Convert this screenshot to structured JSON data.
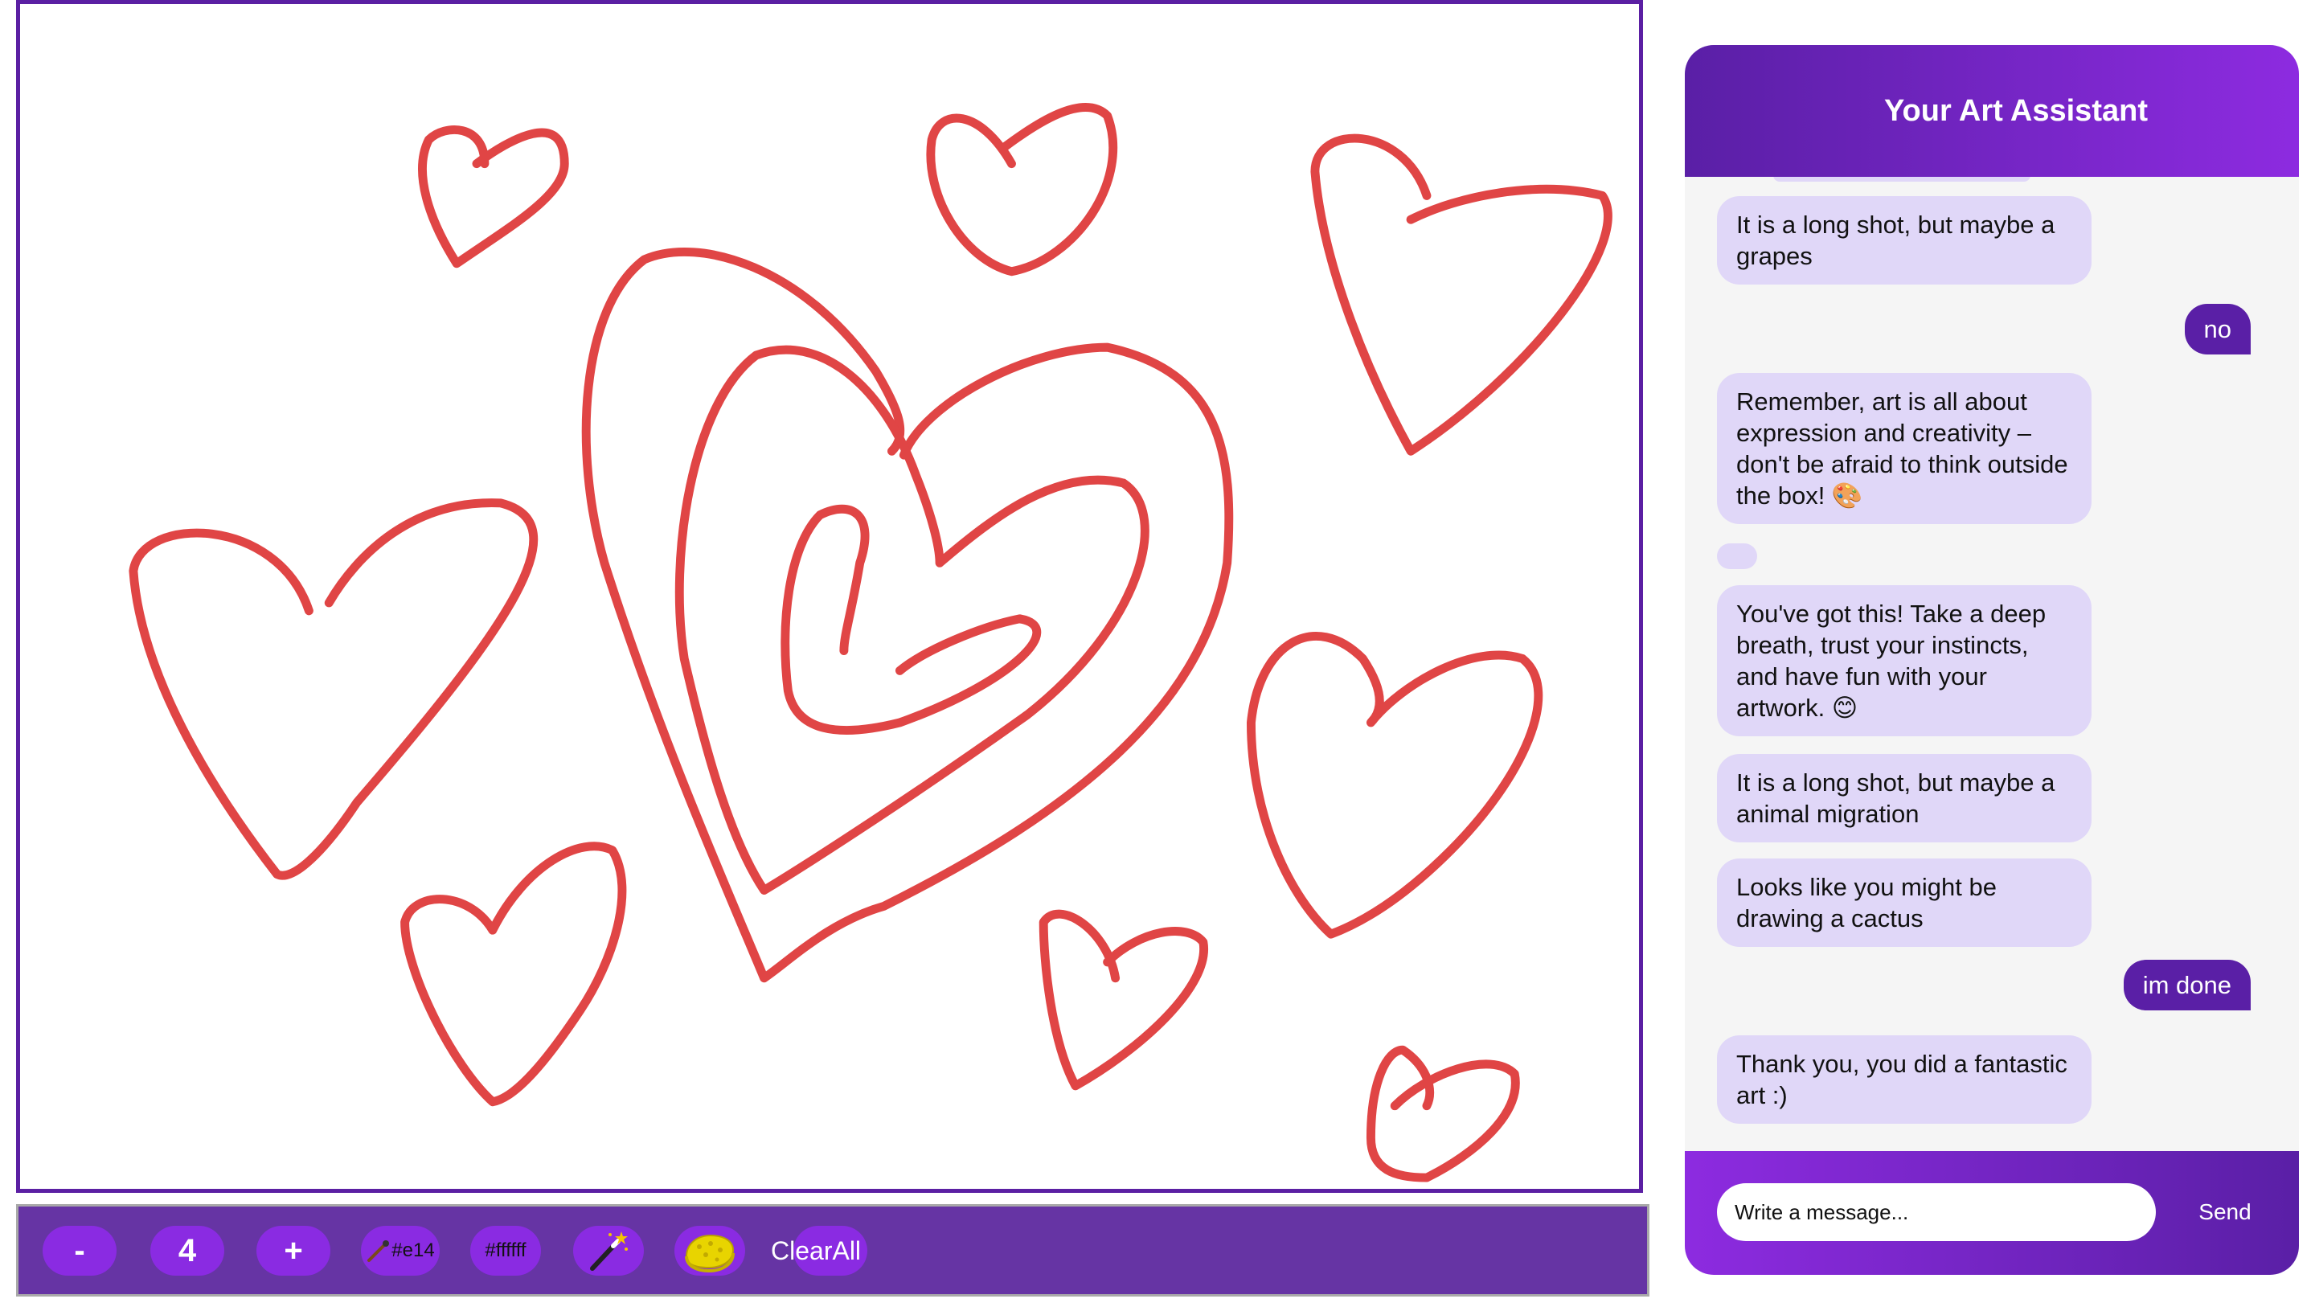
{
  "canvas": {
    "stroke_color": "#e04545",
    "background": "#ffffff",
    "border_color": "#5b1fa3"
  },
  "toolbar": {
    "decrease_label": "-",
    "brush_size": "4",
    "increase_label": "+",
    "brush_color_label": "#e14",
    "background_color_label": "#ffffff",
    "magic_wand_icon": "magic-wand-icon",
    "sponge_icon": "sponge-icon",
    "clear_all_label": "ClearAll",
    "background": "#6634a4",
    "pill_color": "#8a2be2"
  },
  "chat": {
    "title": "Your Art Assistant",
    "header_colors": [
      "#5a1fa6",
      "#8d2be0"
    ],
    "messages": [
      {
        "role": "bot",
        "text": "It is a long shot, but maybe a grapes"
      },
      {
        "role": "user",
        "text": "no"
      },
      {
        "role": "bot",
        "text": "Remember, art is all about expression and creativity – don't be afraid to think outside the box! 🎨"
      },
      {
        "role": "bot",
        "text": ""
      },
      {
        "role": "bot",
        "text": "You've got this! Take a deep breath, trust your instincts, and have fun with your artwork. 😊"
      },
      {
        "role": "bot",
        "text": "It is a long shot, but maybe a animal migration"
      },
      {
        "role": "bot",
        "text": "Looks like you might be drawing a cactus"
      },
      {
        "role": "user",
        "text": "im done"
      },
      {
        "role": "bot",
        "text": "Thank you, you did a fantastic art :)"
      }
    ],
    "input_placeholder": "Write a message...",
    "send_label": "Send"
  }
}
